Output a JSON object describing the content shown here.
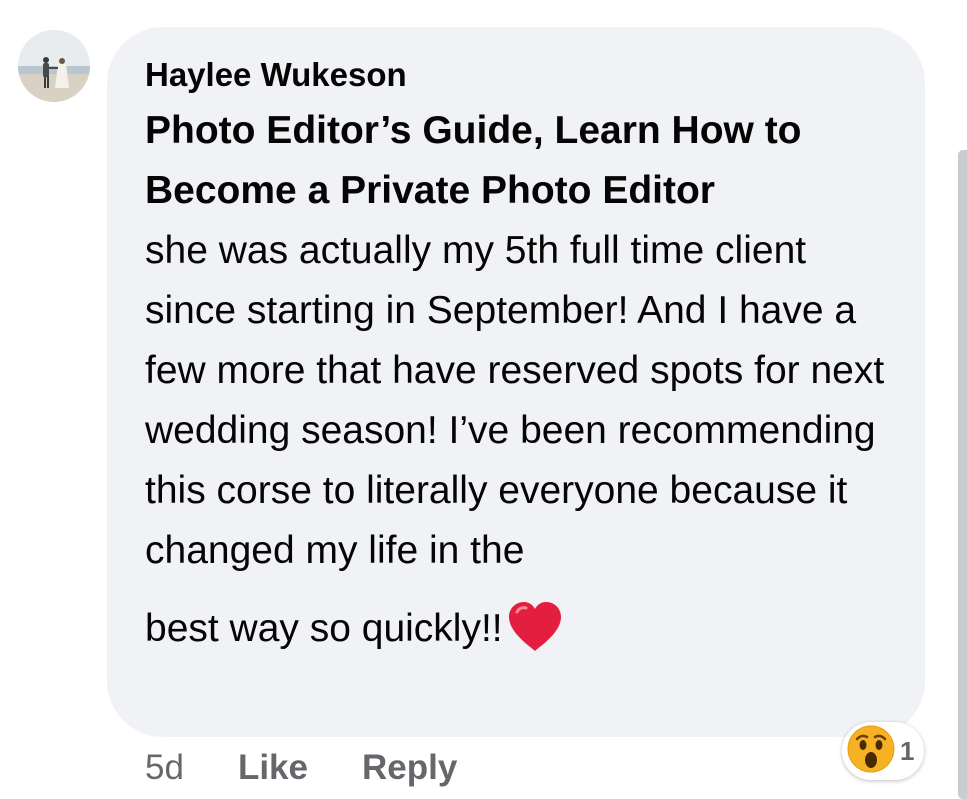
{
  "comment": {
    "author": "Haylee Wukeson",
    "linked_title": "Photo Editor’s Guide, Learn How to Become a Private Photo Editor",
    "body": "she was actually my 5th full time client since starting in September! And I have a few more that have reserved spots for next wedding season! I’ve been recommending this corse to literally everyone because it changed my life in the",
    "last_line": "best way so quickly!!",
    "heart_icon": "red-heart-emoji"
  },
  "actions": {
    "time": "5d",
    "like_label": "Like",
    "reply_label": "Reply"
  },
  "reaction": {
    "icon": "wow-emoji",
    "count": "1"
  },
  "colors": {
    "bubble": "#f0f2f5",
    "text": "#050505",
    "muted": "#65676b",
    "heart": "#e41e3f",
    "wow": "#f7b125"
  }
}
